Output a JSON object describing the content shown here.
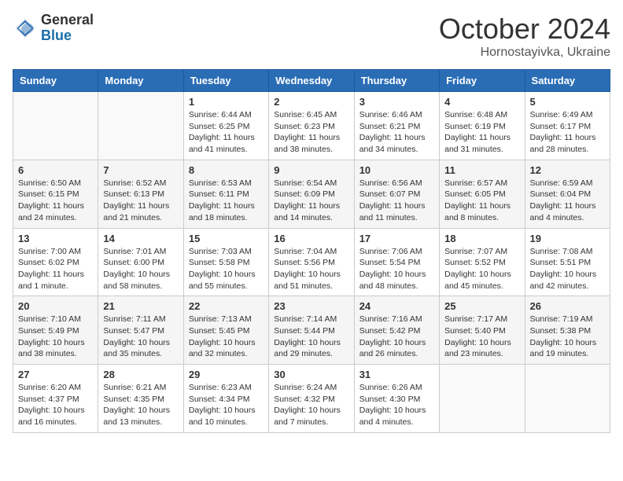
{
  "header": {
    "logo_general": "General",
    "logo_blue": "Blue",
    "month": "October 2024",
    "location": "Hornostayivka, Ukraine"
  },
  "days_of_week": [
    "Sunday",
    "Monday",
    "Tuesday",
    "Wednesday",
    "Thursday",
    "Friday",
    "Saturday"
  ],
  "weeks": [
    [
      {
        "day": "",
        "info": ""
      },
      {
        "day": "",
        "info": ""
      },
      {
        "day": "1",
        "info": "Sunrise: 6:44 AM\nSunset: 6:25 PM\nDaylight: 11 hours and 41 minutes."
      },
      {
        "day": "2",
        "info": "Sunrise: 6:45 AM\nSunset: 6:23 PM\nDaylight: 11 hours and 38 minutes."
      },
      {
        "day": "3",
        "info": "Sunrise: 6:46 AM\nSunset: 6:21 PM\nDaylight: 11 hours and 34 minutes."
      },
      {
        "day": "4",
        "info": "Sunrise: 6:48 AM\nSunset: 6:19 PM\nDaylight: 11 hours and 31 minutes."
      },
      {
        "day": "5",
        "info": "Sunrise: 6:49 AM\nSunset: 6:17 PM\nDaylight: 11 hours and 28 minutes."
      }
    ],
    [
      {
        "day": "6",
        "info": "Sunrise: 6:50 AM\nSunset: 6:15 PM\nDaylight: 11 hours and 24 minutes."
      },
      {
        "day": "7",
        "info": "Sunrise: 6:52 AM\nSunset: 6:13 PM\nDaylight: 11 hours and 21 minutes."
      },
      {
        "day": "8",
        "info": "Sunrise: 6:53 AM\nSunset: 6:11 PM\nDaylight: 11 hours and 18 minutes."
      },
      {
        "day": "9",
        "info": "Sunrise: 6:54 AM\nSunset: 6:09 PM\nDaylight: 11 hours and 14 minutes."
      },
      {
        "day": "10",
        "info": "Sunrise: 6:56 AM\nSunset: 6:07 PM\nDaylight: 11 hours and 11 minutes."
      },
      {
        "day": "11",
        "info": "Sunrise: 6:57 AM\nSunset: 6:05 PM\nDaylight: 11 hours and 8 minutes."
      },
      {
        "day": "12",
        "info": "Sunrise: 6:59 AM\nSunset: 6:04 PM\nDaylight: 11 hours and 4 minutes."
      }
    ],
    [
      {
        "day": "13",
        "info": "Sunrise: 7:00 AM\nSunset: 6:02 PM\nDaylight: 11 hours and 1 minute."
      },
      {
        "day": "14",
        "info": "Sunrise: 7:01 AM\nSunset: 6:00 PM\nDaylight: 10 hours and 58 minutes."
      },
      {
        "day": "15",
        "info": "Sunrise: 7:03 AM\nSunset: 5:58 PM\nDaylight: 10 hours and 55 minutes."
      },
      {
        "day": "16",
        "info": "Sunrise: 7:04 AM\nSunset: 5:56 PM\nDaylight: 10 hours and 51 minutes."
      },
      {
        "day": "17",
        "info": "Sunrise: 7:06 AM\nSunset: 5:54 PM\nDaylight: 10 hours and 48 minutes."
      },
      {
        "day": "18",
        "info": "Sunrise: 7:07 AM\nSunset: 5:52 PM\nDaylight: 10 hours and 45 minutes."
      },
      {
        "day": "19",
        "info": "Sunrise: 7:08 AM\nSunset: 5:51 PM\nDaylight: 10 hours and 42 minutes."
      }
    ],
    [
      {
        "day": "20",
        "info": "Sunrise: 7:10 AM\nSunset: 5:49 PM\nDaylight: 10 hours and 38 minutes."
      },
      {
        "day": "21",
        "info": "Sunrise: 7:11 AM\nSunset: 5:47 PM\nDaylight: 10 hours and 35 minutes."
      },
      {
        "day": "22",
        "info": "Sunrise: 7:13 AM\nSunset: 5:45 PM\nDaylight: 10 hours and 32 minutes."
      },
      {
        "day": "23",
        "info": "Sunrise: 7:14 AM\nSunset: 5:44 PM\nDaylight: 10 hours and 29 minutes."
      },
      {
        "day": "24",
        "info": "Sunrise: 7:16 AM\nSunset: 5:42 PM\nDaylight: 10 hours and 26 minutes."
      },
      {
        "day": "25",
        "info": "Sunrise: 7:17 AM\nSunset: 5:40 PM\nDaylight: 10 hours and 23 minutes."
      },
      {
        "day": "26",
        "info": "Sunrise: 7:19 AM\nSunset: 5:38 PM\nDaylight: 10 hours and 19 minutes."
      }
    ],
    [
      {
        "day": "27",
        "info": "Sunrise: 6:20 AM\nSunset: 4:37 PM\nDaylight: 10 hours and 16 minutes."
      },
      {
        "day": "28",
        "info": "Sunrise: 6:21 AM\nSunset: 4:35 PM\nDaylight: 10 hours and 13 minutes."
      },
      {
        "day": "29",
        "info": "Sunrise: 6:23 AM\nSunset: 4:34 PM\nDaylight: 10 hours and 10 minutes."
      },
      {
        "day": "30",
        "info": "Sunrise: 6:24 AM\nSunset: 4:32 PM\nDaylight: 10 hours and 7 minutes."
      },
      {
        "day": "31",
        "info": "Sunrise: 6:26 AM\nSunset: 4:30 PM\nDaylight: 10 hours and 4 minutes."
      },
      {
        "day": "",
        "info": ""
      },
      {
        "day": "",
        "info": ""
      }
    ]
  ]
}
